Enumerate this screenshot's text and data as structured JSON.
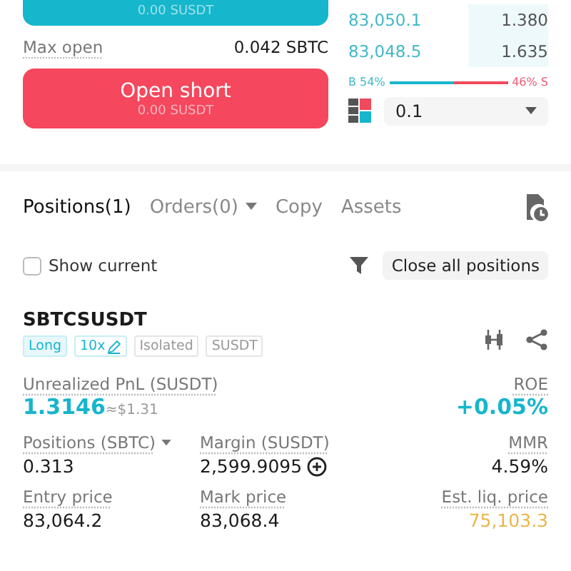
{
  "order_form": {
    "long_button": {
      "subtext": "0.00 SUSDT"
    },
    "max_open": {
      "label": "Max open",
      "value": "0.042 SBTC"
    },
    "short_button": {
      "label": "Open short",
      "subtext": "0.00 SUSDT"
    }
  },
  "order_book": {
    "rows": [
      {
        "price": "83,050.1",
        "amount": "1.380"
      },
      {
        "price": "83,048.5",
        "amount": "1.635"
      }
    ],
    "ratio": {
      "buy_label": "B 54%",
      "sell_label": "46% S",
      "level": 0.54
    },
    "precision": {
      "value": "0.1"
    }
  },
  "tabs": [
    {
      "label": "Positions(1)",
      "selected": true,
      "dropdown": false
    },
    {
      "label": "Orders(0)",
      "selected": false,
      "dropdown": true
    },
    {
      "label": "Copy",
      "selected": false,
      "dropdown": false
    },
    {
      "label": "Assets",
      "selected": false,
      "dropdown": false
    }
  ],
  "filter": {
    "show_current": {
      "label": "Show current",
      "checked": false
    },
    "close_all": "Close all positions"
  },
  "position": {
    "symbol": "SBTCSUSDT",
    "tags": [
      {
        "label": "Long",
        "kind": "side"
      },
      {
        "label": "10x",
        "kind": "leverage"
      },
      {
        "label": "Isolated",
        "kind": "plain"
      },
      {
        "label": "SUSDT",
        "kind": "plain"
      }
    ],
    "pnl": {
      "label": "Unrealized PnL (SUSDT)",
      "value": "1.3146",
      "approx": "≈$1.31"
    },
    "roe": {
      "label": "ROE",
      "value": "+0.05%"
    },
    "fields": [
      {
        "label": "Positions (SBTC)",
        "value": "0.313",
        "kind": "dropdown"
      },
      {
        "label": "Margin (SUSDT)",
        "value": "2,599.9095",
        "kind": "add"
      },
      {
        "label": "MMR",
        "value": "4.59%",
        "kind": "plain"
      },
      {
        "label": "Entry price",
        "value": "83,064.2",
        "kind": "plain"
      },
      {
        "label": "Mark price",
        "value": "83,068.4",
        "kind": "plain"
      },
      {
        "label": "Est. liq. price",
        "value": "75,103.3",
        "kind": "liq"
      }
    ]
  }
}
